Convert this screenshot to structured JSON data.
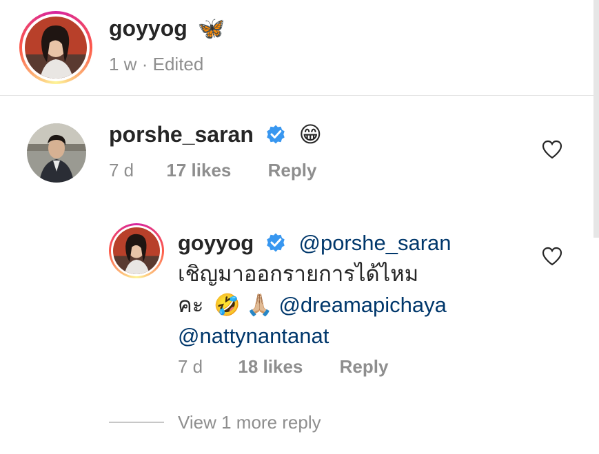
{
  "post_header": {
    "username": "goyyog",
    "emoji": "🦋",
    "time": "1 w",
    "separator": "·",
    "edited": "Edited"
  },
  "comment": {
    "username": "porshe_saran",
    "text_emoji": "😁",
    "time": "7 d",
    "likes": "17 likes",
    "reply_label": "Reply"
  },
  "reply": {
    "username": "goyyog",
    "mention1": "@porshe_saran",
    "line1": "เชิญมาออกรายการได้ไหม",
    "line2_prefix": "คะ",
    "emojis": "🤣 🙏🏼",
    "mention2": "@dreamapichaya",
    "mention3": "@nattynantanat",
    "time": "7 d",
    "likes": "18 likes",
    "reply_label": "Reply"
  },
  "view_more": "View 1 more reply",
  "colors": {
    "text": "#262626",
    "secondary": "#8e8e8e",
    "mention": "#00376b",
    "verified": "#3897f0"
  }
}
